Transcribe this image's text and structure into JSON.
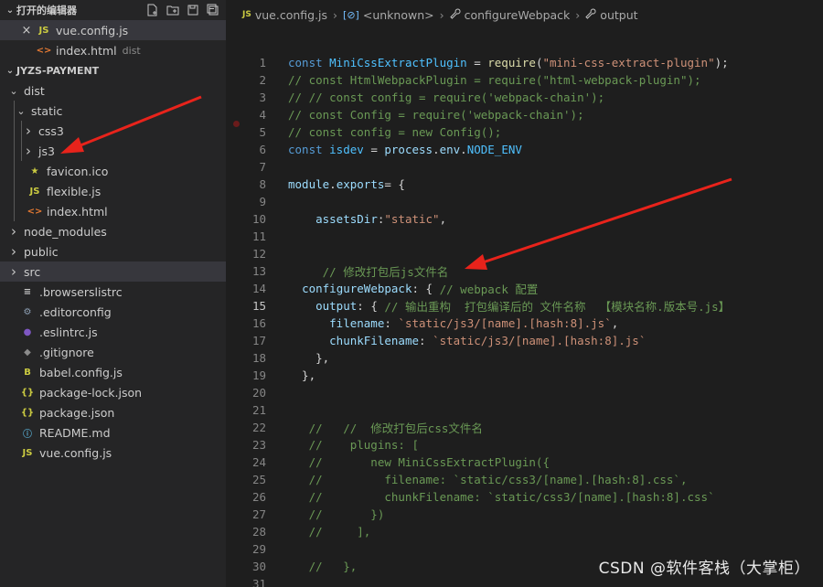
{
  "open_editors": {
    "title": "打开的编辑器",
    "files": [
      {
        "name": "vue.config.js",
        "icon": "JS",
        "selected": true
      },
      {
        "name": "index.html",
        "icon": "<>",
        "dir": "dist"
      }
    ]
  },
  "explorer": {
    "project": "JYZS-PAYMENT",
    "items": [
      {
        "name": "dist",
        "level": 0,
        "twisty": "v",
        "icon": ""
      },
      {
        "name": "static",
        "level": 1,
        "twisty": "v",
        "icon": ""
      },
      {
        "name": "css3",
        "level": 2,
        "twisty": ">",
        "icon": ""
      },
      {
        "name": "js3",
        "level": 2,
        "twisty": ">",
        "icon": ""
      },
      {
        "name": "favicon.ico",
        "level": 1,
        "twisty": "",
        "icon": "★"
      },
      {
        "name": "flexible.js",
        "level": 1,
        "twisty": "",
        "icon": "JS"
      },
      {
        "name": "index.html",
        "level": 1,
        "twisty": "",
        "icon": "<>"
      },
      {
        "name": "node_modules",
        "level": 0,
        "twisty": ">",
        "icon": ""
      },
      {
        "name": "public",
        "level": 0,
        "twisty": ">",
        "icon": ""
      },
      {
        "name": "src",
        "level": 0,
        "twisty": ">",
        "icon": "",
        "selected": true
      },
      {
        "name": ".browserslistrc",
        "level": 0,
        "twisty": "",
        "icon": "≡"
      },
      {
        "name": ".editorconfig",
        "level": 0,
        "twisty": "",
        "icon": "⚙"
      },
      {
        "name": ".eslintrc.js",
        "level": 0,
        "twisty": "",
        "icon": "●"
      },
      {
        "name": ".gitignore",
        "level": 0,
        "twisty": "",
        "icon": "◆"
      },
      {
        "name": "babel.config.js",
        "level": 0,
        "twisty": "",
        "icon": "B"
      },
      {
        "name": "package-lock.json",
        "level": 0,
        "twisty": "",
        "icon": "{}"
      },
      {
        "name": "package.json",
        "level": 0,
        "twisty": "",
        "icon": "{}"
      },
      {
        "name": "README.md",
        "level": 0,
        "twisty": "",
        "icon": "ⓘ"
      },
      {
        "name": "vue.config.js",
        "level": 0,
        "twisty": "",
        "icon": "JS"
      }
    ]
  },
  "breadcrumb": {
    "file": "vue.config.js",
    "unknown": "<unknown>",
    "method": "configureWebpack",
    "prop": "output"
  },
  "colors": {
    "keyword": "#569cd6",
    "variable": "#4fc1ff",
    "function": "#dcdcaa",
    "string": "#ce9178",
    "comment": "#6a9955",
    "property": "#9cdcfe",
    "arrow": "#e8231b"
  },
  "code": [
    {
      "n": "1",
      "tokens": [
        [
          "kw",
          "const "
        ],
        [
          "var",
          "MiniCssExtractPlugin"
        ],
        [
          "plain",
          " = "
        ],
        [
          "fn",
          "require"
        ],
        [
          "plain",
          "("
        ],
        [
          "str",
          "\"mini-css-extract-plugin\""
        ],
        [
          "plain",
          ");"
        ]
      ]
    },
    {
      "n": "2",
      "tokens": [
        [
          "com",
          "// const HtmlWebpackPlugin = require(\"html-webpack-plugin\");"
        ]
      ]
    },
    {
      "n": "3",
      "tokens": [
        [
          "com",
          "// // const config = require('webpack-chain');"
        ]
      ]
    },
    {
      "n": "4",
      "tokens": [
        [
          "com",
          "// const Config = require('webpack-chain');"
        ]
      ],
      "bp": true
    },
    {
      "n": "5",
      "tokens": [
        [
          "com",
          "// const config = new Config();"
        ]
      ]
    },
    {
      "n": "6",
      "tokens": [
        [
          "kw",
          "const "
        ],
        [
          "var",
          "isdev"
        ],
        [
          "plain",
          " = "
        ],
        [
          "prop",
          "process"
        ],
        [
          "plain",
          "."
        ],
        [
          "prop",
          "env"
        ],
        [
          "plain",
          "."
        ],
        [
          "var",
          "NODE_ENV"
        ]
      ]
    },
    {
      "n": "7",
      "tokens": []
    },
    {
      "n": "8",
      "tokens": [
        [
          "prop",
          "module"
        ],
        [
          "plain",
          "."
        ],
        [
          "prop",
          "exports"
        ],
        [
          "plain",
          "= {"
        ]
      ]
    },
    {
      "n": "9",
      "tokens": []
    },
    {
      "n": "10",
      "tokens": [
        [
          "plain",
          "    "
        ],
        [
          "prop",
          "assetsDir"
        ],
        [
          "plain",
          ":"
        ],
        [
          "str",
          "\"static\""
        ],
        [
          "plain",
          ","
        ]
      ]
    },
    {
      "n": "11",
      "tokens": []
    },
    {
      "n": "12",
      "tokens": []
    },
    {
      "n": "13",
      "tokens": [
        [
          "plain",
          "     "
        ],
        [
          "com",
          "// 修改打包后js文件名"
        ]
      ]
    },
    {
      "n": "14",
      "tokens": [
        [
          "plain",
          "  "
        ],
        [
          "prop",
          "configureWebpack"
        ],
        [
          "plain",
          ": { "
        ],
        [
          "com",
          "// webpack 配置"
        ]
      ]
    },
    {
      "n": "15",
      "tokens": [
        [
          "plain",
          "    "
        ],
        [
          "prop",
          "output"
        ],
        [
          "plain",
          ": { "
        ],
        [
          "com",
          "// 输出重构  打包编译后的 文件名称  【模块名称.版本号.js】"
        ]
      ],
      "active": true
    },
    {
      "n": "16",
      "tokens": [
        [
          "plain",
          "      "
        ],
        [
          "prop",
          "filename"
        ],
        [
          "plain",
          ": "
        ],
        [
          "str",
          "`static/js3/[name].[hash:8].js`"
        ],
        [
          "plain",
          ","
        ]
      ]
    },
    {
      "n": "17",
      "tokens": [
        [
          "plain",
          "      "
        ],
        [
          "prop",
          "chunkFilename"
        ],
        [
          "plain",
          ": "
        ],
        [
          "str",
          "`static/js3/[name].[hash:8].js`"
        ]
      ]
    },
    {
      "n": "18",
      "tokens": [
        [
          "plain",
          "    },"
        ]
      ]
    },
    {
      "n": "19",
      "tokens": [
        [
          "plain",
          "  },"
        ]
      ]
    },
    {
      "n": "20",
      "tokens": []
    },
    {
      "n": "21",
      "tokens": []
    },
    {
      "n": "22",
      "tokens": [
        [
          "plain",
          "   "
        ],
        [
          "com",
          "//   //  修改打包后css文件名"
        ]
      ]
    },
    {
      "n": "23",
      "tokens": [
        [
          "plain",
          "   "
        ],
        [
          "com",
          "//    plugins: ["
        ]
      ]
    },
    {
      "n": "24",
      "tokens": [
        [
          "plain",
          "   "
        ],
        [
          "com",
          "//       new MiniCssExtractPlugin({"
        ]
      ]
    },
    {
      "n": "25",
      "tokens": [
        [
          "plain",
          "   "
        ],
        [
          "com",
          "//         filename: `static/css3/[name].[hash:8].css`,"
        ]
      ]
    },
    {
      "n": "26",
      "tokens": [
        [
          "plain",
          "   "
        ],
        [
          "com",
          "//         chunkFilename: `static/css3/[name].[hash:8].css`"
        ]
      ]
    },
    {
      "n": "27",
      "tokens": [
        [
          "plain",
          "   "
        ],
        [
          "com",
          "//       })"
        ]
      ]
    },
    {
      "n": "28",
      "tokens": [
        [
          "plain",
          "   "
        ],
        [
          "com",
          "//     ],"
        ]
      ]
    },
    {
      "n": "29",
      "tokens": []
    },
    {
      "n": "30",
      "tokens": [
        [
          "plain",
          "   "
        ],
        [
          "com",
          "//   },"
        ]
      ]
    },
    {
      "n": "31",
      "tokens": []
    }
  ],
  "watermark": "CSDN @软件客栈（大掌柜）"
}
